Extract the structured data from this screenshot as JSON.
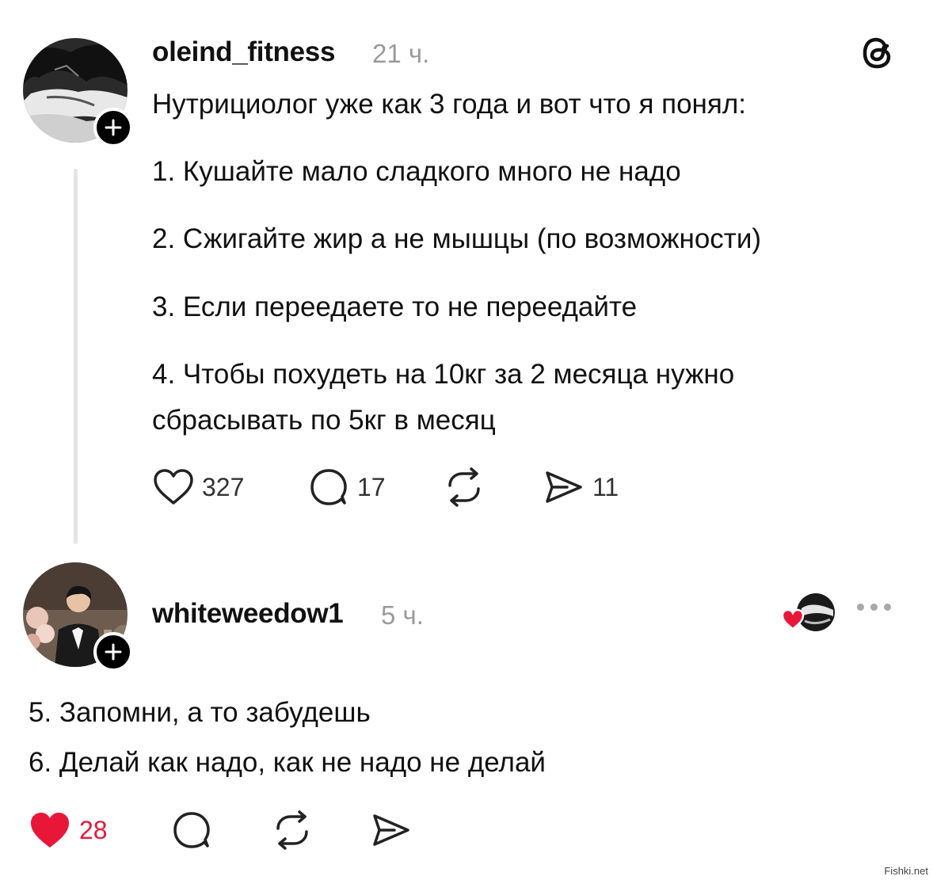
{
  "post": {
    "username": "oleind_fitness",
    "time": "21 ч.",
    "lines": [
      "Нутрициолог уже как 3 года и вот что я понял:",
      "1. Кушайте мало сладкого много не надо",
      "2. Сжигайте жир а не мышцы (по возможности)",
      "3. Если переедаете то не переедайте",
      "4. Чтобы похудеть на 10кг за 2 месяца нужно",
      "сбрасывать по 5кг в месяц"
    ],
    "likes": "327",
    "comments": "17",
    "shares": "11"
  },
  "reply": {
    "username": "whiteweedow1",
    "time": "5 ч.",
    "lines": [
      "5. Запомни, а то забудешь",
      "6. Делай как надо, как не надо не делай"
    ],
    "likes": "28"
  },
  "watermark": "Fishki.net",
  "colors": {
    "like_active": "#e8173a",
    "muted_text": "#9a9a9a",
    "thread_line": "#e4e4e4"
  },
  "icons": [
    "plus-icon",
    "threads-logo-icon",
    "heart-icon",
    "comment-icon",
    "repost-icon",
    "share-icon",
    "more-icon"
  ]
}
